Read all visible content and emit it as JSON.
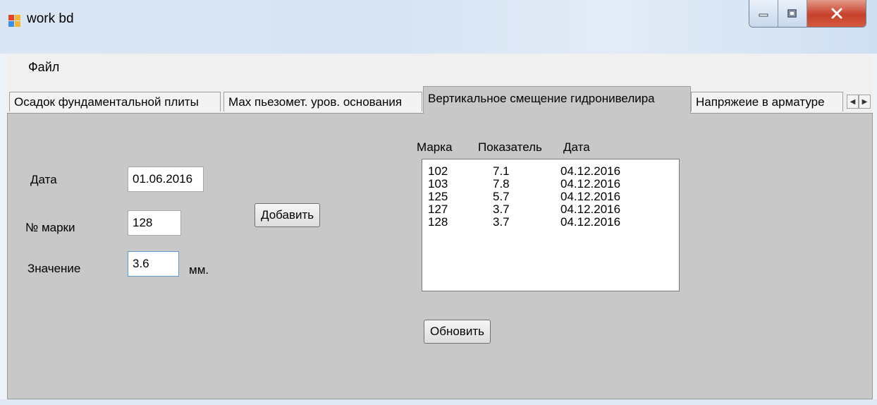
{
  "window": {
    "title": "work bd"
  },
  "menu": {
    "file": "Файл"
  },
  "tabs": [
    {
      "label": "Осадок фундаментальной плиты"
    },
    {
      "label": "Мах пьезомет. уров. основания"
    },
    {
      "label": "Вертикальное смещение гидронивелира"
    },
    {
      "label": "Напряжеие в арматуре"
    }
  ],
  "form": {
    "date_label": "Дата",
    "date_value": "01.06.2016",
    "mark_label": "№ марки",
    "mark_value": "128",
    "value_label": "Значение",
    "value_value": "3.6",
    "unit": "мм.",
    "add_button": "Добавить",
    "refresh_button": "Обновить"
  },
  "list": {
    "headers": {
      "mark": "Марка",
      "value": "Показатель",
      "date": "Дата"
    },
    "rows": [
      {
        "mark": "102",
        "value": "7.1",
        "date": "04.12.2016"
      },
      {
        "mark": "103",
        "value": "7.8",
        "date": "04.12.2016"
      },
      {
        "mark": "125",
        "value": "5.7",
        "date": "04.12.2016"
      },
      {
        "mark": "127",
        "value": "3.7",
        "date": "04.12.2016"
      },
      {
        "mark": "128",
        "value": "3.7",
        "date": "04.12.2016"
      }
    ]
  },
  "icons": {
    "app": "app-window-icon",
    "minimize": "minimize-icon",
    "maximize": "maximize-icon",
    "close": "close-icon",
    "tab_left": "chevron-left-icon",
    "tab_right": "chevron-right-icon"
  },
  "colors": {
    "panel_bg": "#c8c8c8",
    "close_red": "#c7402a",
    "titlebar": "#d7e4f4"
  }
}
